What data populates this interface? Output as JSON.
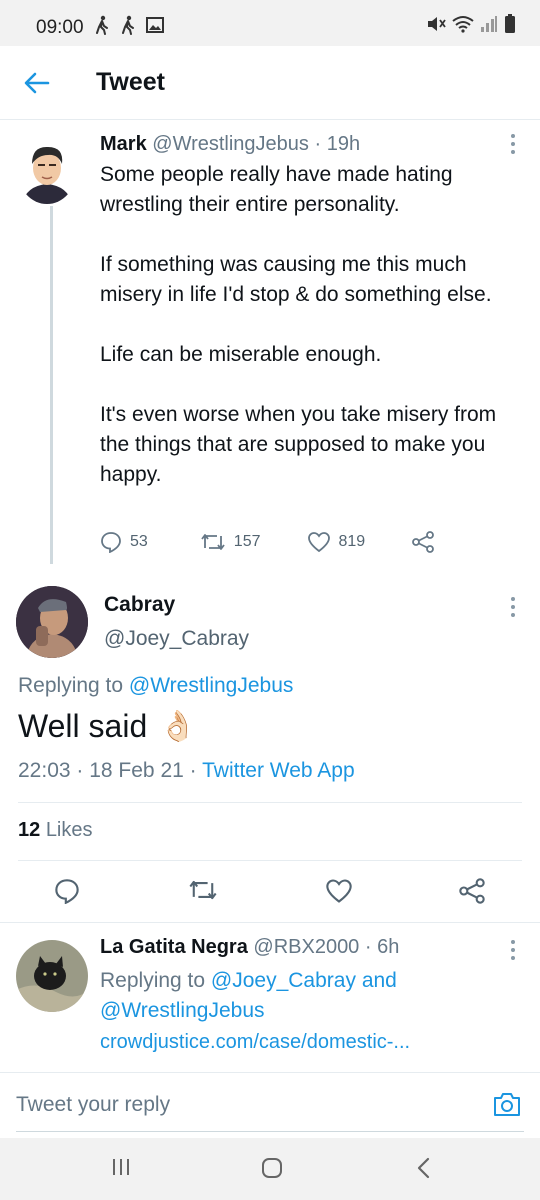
{
  "status_bar": {
    "time": "09:00"
  },
  "header": {
    "title": "Tweet"
  },
  "parent_tweet": {
    "name": "Mark",
    "handle": "@WrestlingJebus",
    "age": "· 19h",
    "text": "Some people really have made hating wrestling their entire personality.\n\nIf something was causing me this much misery in life I'd stop & do something else.\n\nLife can be miserable enough.\n\nIt's even worse when you take misery from the things that are supposed to make you happy.",
    "replies": "53",
    "retweets": "157",
    "likes": "819"
  },
  "main_tweet": {
    "name": "Cabray",
    "handle": "@Joey_Cabray",
    "replying_prefix": "Replying to",
    "replying_to": "@WrestlingJebus",
    "text": "Well said",
    "emoji": "👌🏻",
    "time": "22:03",
    "date": "18 Feb 21",
    "source": "Twitter Web App",
    "likes_count": "12",
    "likes_label": "Likes"
  },
  "reply_tweet": {
    "name": "La Gatita Negra",
    "handle": "@RBX2000",
    "age": "· 6h",
    "replying_prefix": "Replying to",
    "replying_to_1": "@Joey_Cabray",
    "and": "and",
    "replying_to_2": "@WrestlingJebus",
    "link": "crowdjustice.com/case/domestic-..."
  },
  "composer": {
    "placeholder": "Tweet your reply"
  },
  "colors": {
    "accent": "#1b95e0",
    "secondary_text": "#657786",
    "divider": "#e6ecf0"
  }
}
